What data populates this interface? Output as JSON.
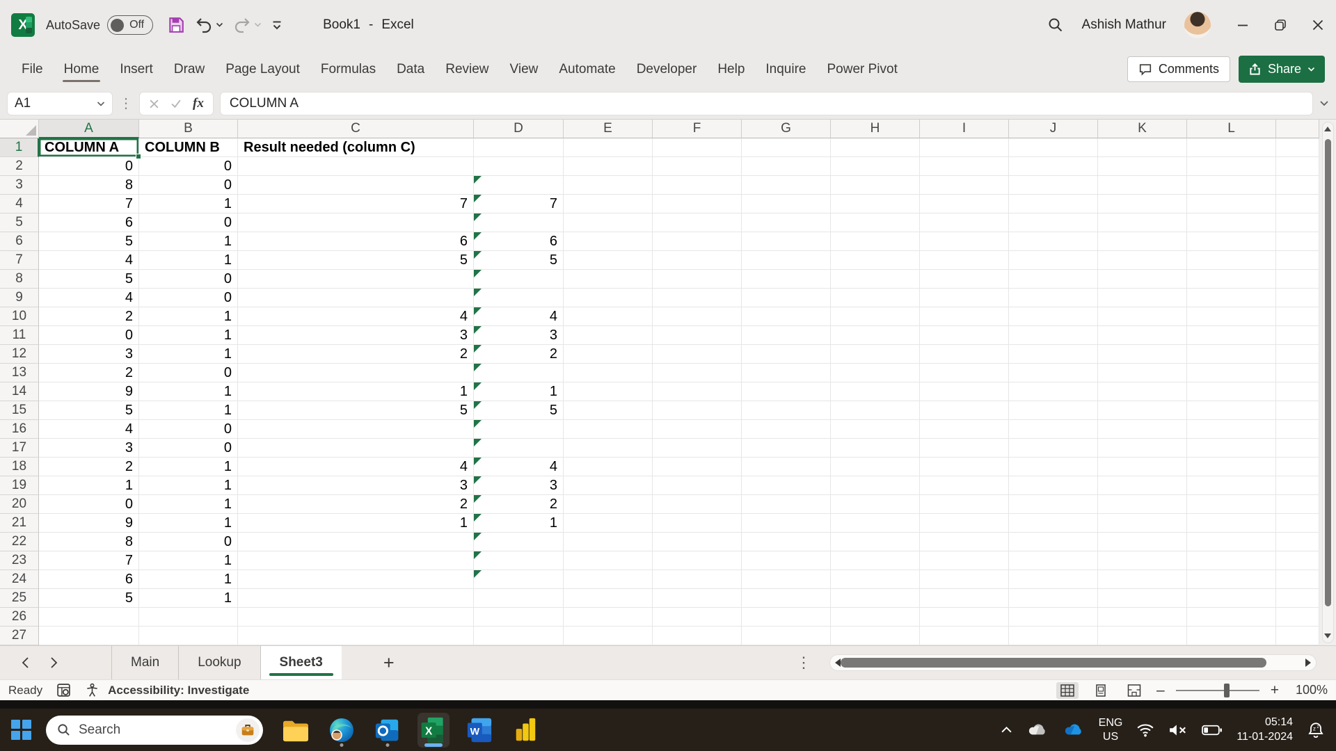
{
  "title_bar": {
    "autosave_label": "AutoSave",
    "autosave_state": "Off",
    "doc_name": "Book1",
    "separator": "-",
    "app_name": "Excel",
    "user_name": "Ashish Mathur"
  },
  "ribbon": {
    "tabs": [
      "File",
      "Home",
      "Insert",
      "Draw",
      "Page Layout",
      "Formulas",
      "Data",
      "Review",
      "View",
      "Automate",
      "Developer",
      "Help",
      "Inquire",
      "Power Pivot"
    ],
    "active_tab": "Home",
    "comments_label": "Comments",
    "share_label": "Share"
  },
  "formula_bar": {
    "name_box_value": "A1",
    "fx_label": "fx",
    "formula_value": "COLUMN A"
  },
  "grid": {
    "column_letters": [
      "A",
      "B",
      "C",
      "D",
      "E",
      "F",
      "G",
      "H",
      "I",
      "J",
      "K",
      "L"
    ],
    "selected_column": "A",
    "selected_row": 1,
    "selected_cell": "A1",
    "rows": [
      {
        "n": 1,
        "a": "COLUMN A",
        "b": "COLUMN B",
        "c": "Result needed (column C)",
        "d": "",
        "header": true,
        "flag": false
      },
      {
        "n": 2,
        "a": "0",
        "b": "0",
        "c": "",
        "d": "",
        "flag": false
      },
      {
        "n": 3,
        "a": "8",
        "b": "0",
        "c": "",
        "d": "",
        "flag": true
      },
      {
        "n": 4,
        "a": "7",
        "b": "1",
        "c": "7",
        "d": "7",
        "flag": true
      },
      {
        "n": 5,
        "a": "6",
        "b": "0",
        "c": "",
        "d": "",
        "flag": true
      },
      {
        "n": 6,
        "a": "5",
        "b": "1",
        "c": "6",
        "d": "6",
        "flag": true
      },
      {
        "n": 7,
        "a": "4",
        "b": "1",
        "c": "5",
        "d": "5",
        "flag": true
      },
      {
        "n": 8,
        "a": "5",
        "b": "0",
        "c": "",
        "d": "",
        "flag": true
      },
      {
        "n": 9,
        "a": "4",
        "b": "0",
        "c": "",
        "d": "",
        "flag": true
      },
      {
        "n": 10,
        "a": "2",
        "b": "1",
        "c": "4",
        "d": "4",
        "flag": true
      },
      {
        "n": 11,
        "a": "0",
        "b": "1",
        "c": "3",
        "d": "3",
        "flag": true
      },
      {
        "n": 12,
        "a": "3",
        "b": "1",
        "c": "2",
        "d": "2",
        "flag": true
      },
      {
        "n": 13,
        "a": "2",
        "b": "0",
        "c": "",
        "d": "",
        "flag": true
      },
      {
        "n": 14,
        "a": "9",
        "b": "1",
        "c": "1",
        "d": "1",
        "flag": true
      },
      {
        "n": 15,
        "a": "5",
        "b": "1",
        "c": "5",
        "d": "5",
        "flag": true
      },
      {
        "n": 16,
        "a": "4",
        "b": "0",
        "c": "",
        "d": "",
        "flag": true
      },
      {
        "n": 17,
        "a": "3",
        "b": "0",
        "c": "",
        "d": "",
        "flag": true
      },
      {
        "n": 18,
        "a": "2",
        "b": "1",
        "c": "4",
        "d": "4",
        "flag": true
      },
      {
        "n": 19,
        "a": "1",
        "b": "1",
        "c": "3",
        "d": "3",
        "flag": true
      },
      {
        "n": 20,
        "a": "0",
        "b": "1",
        "c": "2",
        "d": "2",
        "flag": true
      },
      {
        "n": 21,
        "a": "9",
        "b": "1",
        "c": "1",
        "d": "1",
        "flag": true
      },
      {
        "n": 22,
        "a": "8",
        "b": "0",
        "c": "",
        "d": "",
        "flag": true
      },
      {
        "n": 23,
        "a": "7",
        "b": "1",
        "c": "",
        "d": "",
        "flag": true
      },
      {
        "n": 24,
        "a": "6",
        "b": "1",
        "c": "",
        "d": "",
        "flag": true
      },
      {
        "n": 25,
        "a": "5",
        "b": "1",
        "c": "",
        "d": "",
        "flag": false
      },
      {
        "n": 26,
        "a": "",
        "b": "",
        "c": "",
        "d": "",
        "flag": false
      },
      {
        "n": 27,
        "a": "",
        "b": "",
        "c": "",
        "d": "",
        "flag": false
      }
    ]
  },
  "sheet_bar": {
    "tabs": [
      "Main",
      "Lookup",
      "Sheet3"
    ],
    "active_tab": "Sheet3",
    "add_sheet_label": "+"
  },
  "status_bar": {
    "ready_label": "Ready",
    "accessibility_label": "Accessibility: Investigate",
    "zoom_minus": "—",
    "zoom_plus": "+",
    "zoom_level": "100%"
  },
  "taskbar": {
    "search_placeholder": "Search",
    "language_line1": "ENG",
    "language_line2": "US",
    "time": "05:14",
    "date": "11-01-2024"
  },
  "colors": {
    "excel_green": "#107C41",
    "selection_green": "#217346",
    "share_green": "#1B6F43",
    "save_purple": "#A43FB1",
    "taskbar_bg": "#262019"
  }
}
